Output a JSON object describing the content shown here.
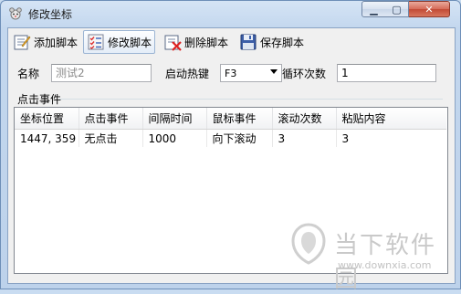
{
  "window": {
    "title": "修改坐标"
  },
  "toolbar": {
    "add_label": "添加脚本",
    "edit_label": "修改脚本",
    "delete_label": "删除脚本",
    "save_label": "保存脚本"
  },
  "form": {
    "name_label": "名称",
    "name_placeholder": "测试2",
    "hotkey_label": "启动热键",
    "hotkey_value": "F3",
    "loop_label": "循环次数",
    "loop_value": "1"
  },
  "group": {
    "title": "点击事件"
  },
  "table": {
    "columns": [
      "坐标位置",
      "点击事件",
      "间隔时间",
      "鼠标事件",
      "滚动次数",
      "粘贴内容"
    ],
    "rows": [
      [
        "1447, 359",
        "无点击",
        "1000",
        "向下滚动",
        "3",
        "3"
      ]
    ]
  },
  "watermark": {
    "brand": "当下软件园",
    "url": "www.downxia.com"
  },
  "colors": {
    "title_bg": "#c3d7ee",
    "close_button": "#c14a35",
    "client_bg": "#f0f0f0"
  }
}
